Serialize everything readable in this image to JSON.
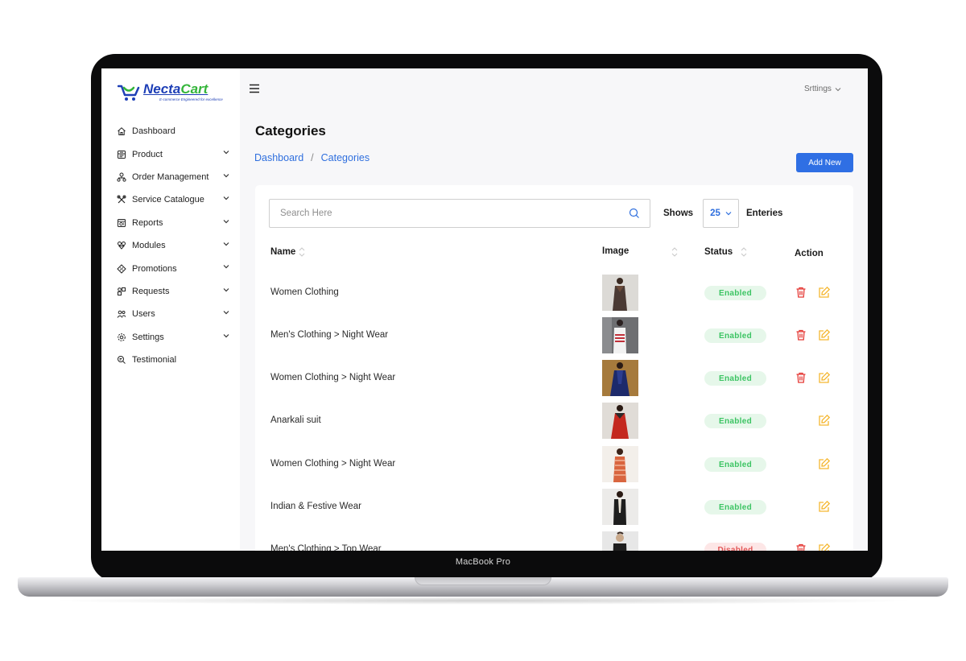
{
  "device": {
    "label": "MacBook Pro"
  },
  "brand": {
    "name_part1": "Necta",
    "name_part2": "Cart",
    "tagline": "E-commerce Engineered for excellence"
  },
  "topbar": {
    "settings_label": "Srttings"
  },
  "sidebar": {
    "items": [
      {
        "label": "Dashboard",
        "icon": "home-icon",
        "has_chevron": false
      },
      {
        "label": "Product",
        "icon": "product-icon",
        "has_chevron": true
      },
      {
        "label": "Order Management",
        "icon": "order-management-icon",
        "has_chevron": true
      },
      {
        "label": "Service Catalogue",
        "icon": "service-catalogue-icon",
        "has_chevron": true
      },
      {
        "label": "Reports",
        "icon": "reports-icon",
        "has_chevron": true
      },
      {
        "label": "Modules",
        "icon": "modules-icon",
        "has_chevron": true
      },
      {
        "label": "Promotions",
        "icon": "promotions-icon",
        "has_chevron": true
      },
      {
        "label": "Requests",
        "icon": "requests-icon",
        "has_chevron": true
      },
      {
        "label": "Users",
        "icon": "users-icon",
        "has_chevron": true
      },
      {
        "label": "Settings",
        "icon": "settings-icon",
        "has_chevron": true
      },
      {
        "label": "Testimonial",
        "icon": "testimonial-icon",
        "has_chevron": false
      }
    ]
  },
  "page": {
    "title": "Categories",
    "breadcrumb": [
      "Dashboard",
      "Categories"
    ],
    "breadcrumb_sep": "/",
    "add_button": "Add New"
  },
  "search": {
    "placeholder": "Search Here"
  },
  "pagination": {
    "shows_label": "Shows",
    "page_size": "25",
    "entries_label": "Enteries"
  },
  "table": {
    "headers": {
      "name": "Name",
      "image": "Image",
      "status": "Status",
      "action": "Action"
    },
    "rows": [
      {
        "name": "Women Clothing",
        "status": "Enabled",
        "enabled": true,
        "deletable": true
      },
      {
        "name": "Men's Clothing > Night Wear",
        "status": "Enabled",
        "enabled": true,
        "deletable": true
      },
      {
        "name": "Women Clothing > Night Wear",
        "status": "Enabled",
        "enabled": true,
        "deletable": true
      },
      {
        "name": "Anarkali suit",
        "status": "Enabled",
        "enabled": true,
        "deletable": false
      },
      {
        "name": "Women Clothing > Night Wear",
        "status": "Enabled",
        "enabled": true,
        "deletable": false
      },
      {
        "name": "Indian & Festive Wear",
        "status": "Enabled",
        "enabled": true,
        "deletable": false
      },
      {
        "name": "Men's Clothing > Top Wear",
        "status": "Disabled",
        "enabled": false,
        "deletable": true
      }
    ]
  },
  "colors": {
    "accent": "#2f6fe4",
    "enabled": "#3cc463",
    "disabled": "#e05555",
    "delete": "#e53935",
    "edit": "#f5b731",
    "brand_blue": "#1e3fb6",
    "brand_green": "#34b53a"
  }
}
